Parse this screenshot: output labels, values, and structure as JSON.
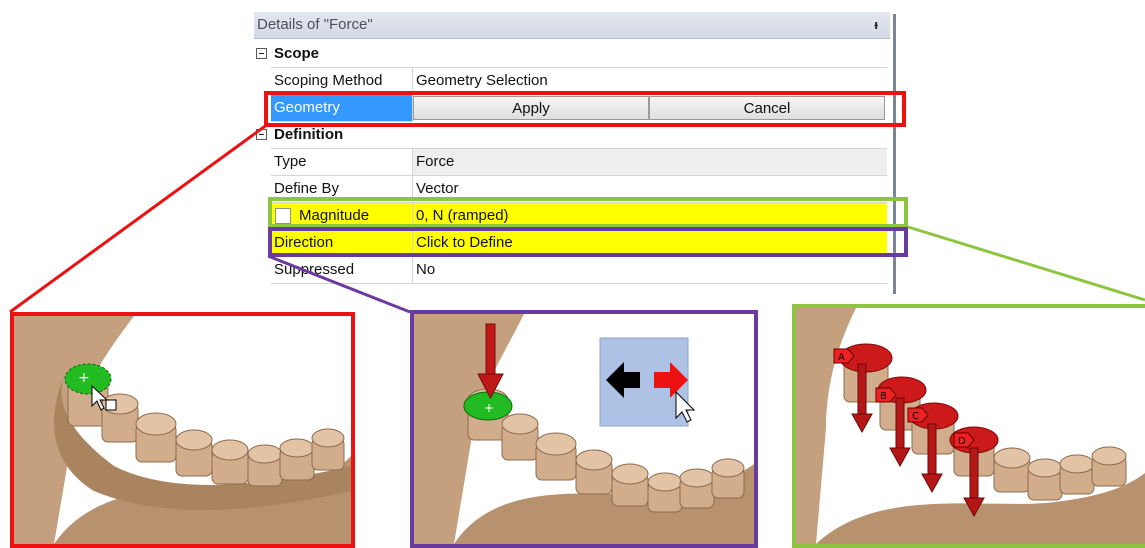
{
  "panel": {
    "title": "Details of \"Force\"",
    "pin_icon": "pin-icon",
    "sections": {
      "scope": "Scope",
      "definition": "Definition"
    },
    "rows": {
      "scoping_method": {
        "label": "Scoping Method",
        "value": "Geometry Selection"
      },
      "geometry": {
        "label": "Geometry",
        "apply": "Apply",
        "cancel": "Cancel"
      },
      "type": {
        "label": "Type",
        "value": "Force"
      },
      "define_by": {
        "label": "Define By",
        "value": "Vector"
      },
      "magnitude": {
        "label": "Magnitude",
        "value": "0, N  (ramped)"
      },
      "direction": {
        "label": "Direction",
        "value": "Click to Define"
      },
      "suppressed": {
        "label": "Suppressed",
        "value": "No"
      }
    }
  },
  "callouts": {
    "green_labels": [
      "A",
      "B",
      "C",
      "D"
    ]
  },
  "colors": {
    "red_highlight": "#ee1111",
    "purple_highlight": "#6b3a9e",
    "green_highlight": "#8cc63f",
    "selected_cell": "#3399ff",
    "yellow_cell": "#ffff00",
    "tooth": "#c9a27f",
    "selection_green": "#22bb22",
    "force_arrow": "#c01818"
  }
}
